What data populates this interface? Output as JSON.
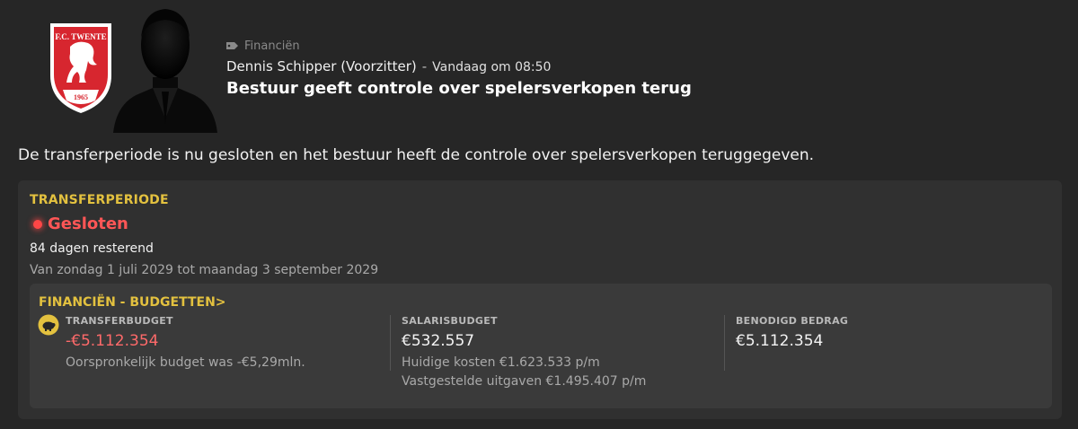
{
  "header": {
    "club_logo": {
      "icon": "fc-twente-crest-icon",
      "text_top": "F.C. TWENTE",
      "text_year": "1965",
      "colors": {
        "primary": "#d7262f",
        "secondary": "#ffffff"
      }
    },
    "avatar_icon": "silhouette-avatar-icon",
    "category_icon": "tag-icon",
    "category": "Financiën",
    "sender": "Dennis Schipper (Voorzitter)",
    "separator": "-",
    "time": "Vandaag om 08:50",
    "headline": "Bestuur geeft controle over spelersverkopen terug"
  },
  "intro": "De transferperiode is nu gesloten en het bestuur heeft de controle over spelersverkopen teruggegeven.",
  "transfer_window": {
    "title": "TRANSFERPERIODE",
    "status": "Gesloten",
    "status_color": "#ff5656",
    "remaining": "84 dagen resterend",
    "period": "Van zondag 1 juli 2029 tot maandag 3 september 2029"
  },
  "budgets": {
    "title": "FINANCIËN - BUDGETTEN",
    "title_chevron": ">",
    "icon": "piggy-bank-icon",
    "columns": [
      {
        "label": "TRANSFERBUDGET",
        "value": "-€5.112.354",
        "subs": [
          "Oorspronkelijk budget was -€5,29mln."
        ]
      },
      {
        "label": "SALARISBUDGET",
        "value": "€532.557",
        "subs": [
          "Huidige kosten €1.623.533 p/m",
          "Vastgestelde uitgaven €1.495.407 p/m"
        ]
      },
      {
        "label": "BENODIGD BEDRAG",
        "value": "€5.112.354",
        "subs": []
      }
    ]
  },
  "colors": {
    "background": "#262626",
    "panel": "#303030",
    "inner_panel": "#3a3a3a",
    "accent": "#e3c13f",
    "negative": "#ff6a6a"
  }
}
